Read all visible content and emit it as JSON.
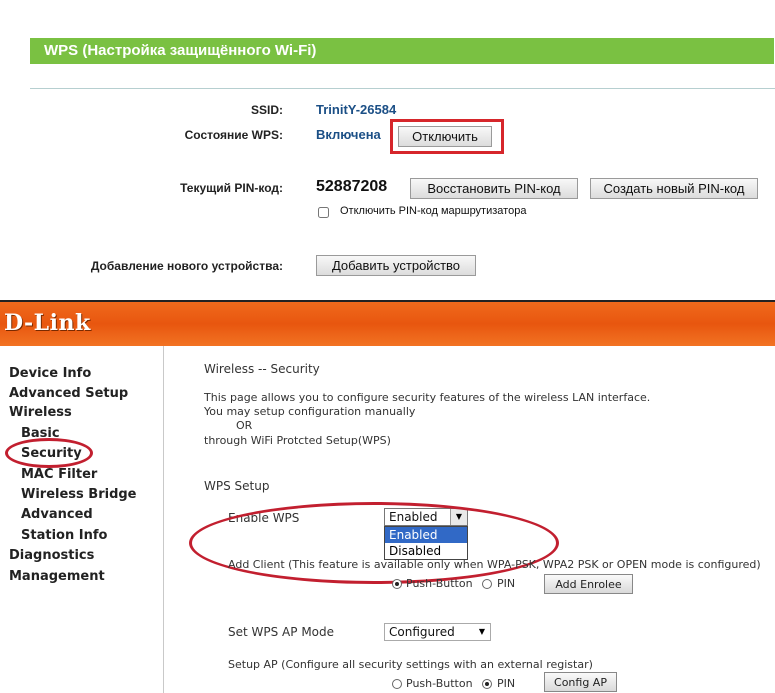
{
  "tplink": {
    "title": "WPS (Настройка защищённого Wi-Fi)",
    "ssid_label": "SSID:",
    "ssid_value": "TrinitY-26584",
    "state_label": "Состояние WPS:",
    "state_value": "Включена",
    "disable_button": "Отключить",
    "pin_label": "Текущий PIN-код:",
    "pin_value": "52887208",
    "restore_pin_button": "Восстановить PIN-код",
    "new_pin_button": "Создать новый PIN-код",
    "disable_pin_checkbox_label": "Отключить PIN-код маршрутизатора",
    "add_device_label": "Добавление нового устройства:",
    "add_device_button": "Добавить устройство"
  },
  "dlink": {
    "logo": "D-Link",
    "nav": [
      "Device Info",
      "Advanced Setup",
      "Wireless",
      "Basic",
      "Security",
      "MAC Filter",
      "Wireless Bridge",
      "Advanced",
      "Station Info",
      "Diagnostics",
      "Management"
    ],
    "page_title": "Wireless -- Security",
    "desc_line1": "This page allows you to configure security features of the wireless LAN interface.",
    "desc_line2": "You may setup configuration manually",
    "desc_or": "OR",
    "desc_line3": "through WiFi Protcted Setup(WPS)",
    "wps_setup_heading": "WPS Setup",
    "enable_wps_label": "Enable WPS",
    "enable_wps_selected": "Enabled",
    "enable_wps_options": [
      "Enabled",
      "Disabled"
    ],
    "add_client_text": "Add Client (This feature is available only when WPA-PSK, WPA2 PSK or OPEN mode is configured)",
    "push_button_label": "Push-Button",
    "pin_label": "PIN",
    "add_enrolee_button": "Add Enrolee",
    "ap_mode_label": "Set WPS AP Mode",
    "ap_mode_selected": "Configured",
    "setup_ap_text": "Setup AP (Configure all security settings with an external registar)",
    "config_ap_button": "Config AP"
  },
  "colors": {
    "tplink_green": "#7ac142",
    "dlink_orange": "#e8560f",
    "highlight_red": "#d6262b",
    "link_blue": "#1b4f86",
    "selection_blue": "#3169c6"
  }
}
